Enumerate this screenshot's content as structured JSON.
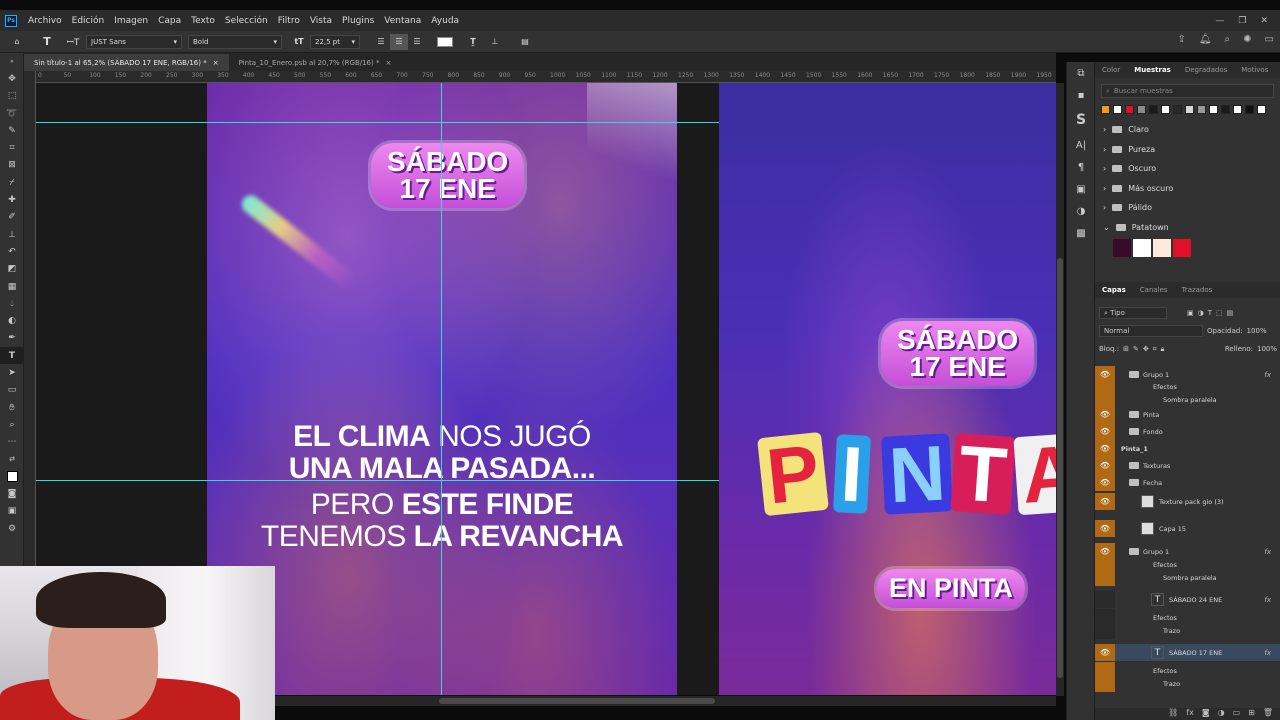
{
  "menubar": {
    "logo": "Ps",
    "items": [
      "Archivo",
      "Edición",
      "Imagen",
      "Capa",
      "Texto",
      "Selección",
      "Filtro",
      "Vista",
      "Plugins",
      "Ventana",
      "Ayuda"
    ],
    "window_controls": [
      "—",
      "❐",
      "✕"
    ]
  },
  "options_bar": {
    "font_family": "JUST Sans",
    "font_style": "Bold",
    "font_size": "22,5 pt",
    "text_color": "#ffffff"
  },
  "doc_tabs": [
    {
      "label": "Sin título-1 al 65,2% (SÁBADO 17 ENE, RGB/16) *",
      "active": true
    },
    {
      "label": "Pinta_10_Enero.psb al 20,7% (RGB/16) *",
      "active": false
    }
  ],
  "ruler_ticks": [
    "0",
    "50",
    "100",
    "150",
    "200",
    "250",
    "300",
    "350",
    "400",
    "450",
    "500",
    "550",
    "600",
    "650",
    "700",
    "750",
    "800",
    "850",
    "900",
    "950",
    "1000",
    "1050",
    "1100",
    "1150",
    "1200",
    "1250",
    "1300",
    "1350",
    "1400",
    "1450",
    "1500",
    "1550",
    "1600",
    "1650",
    "1700",
    "1750",
    "1800",
    "1850",
    "1900",
    "1950"
  ],
  "artboard1": {
    "date_line1": "SÁBADO",
    "date_line2": "17 ENE",
    "line1_bold": "EL CLIMA",
    "line1_light": "NOS JUGÓ",
    "line2_bold": "UNA MALA PASADA...",
    "line3_light": "PERO",
    "line3_bold": "ESTE FINDE",
    "line4_light": "TENEMOS",
    "line4_bold": "LA REVANCHA"
  },
  "artboard2": {
    "date_line1": "SÁBADO",
    "date_line2": "17 ENE",
    "logo_letters": [
      "P",
      "I",
      "N",
      "T",
      "A"
    ],
    "badge": "EN PINTA"
  },
  "swatches_panel": {
    "tabs": [
      "Color",
      "Muestras",
      "Degradados",
      "Motivos"
    ],
    "active_tab": "Muestras",
    "search_placeholder": "Buscar muestras",
    "recent_colors": [
      "#f39a1c",
      "#ffffff",
      "#e0102a",
      "#8a8a8a",
      "#1a1a1a",
      "#ffffff",
      "#2a2a2a",
      "#d8d8d8",
      "#9a9a9a",
      "#ffffff",
      "#1a1a1a",
      "#ffffff",
      "#111111",
      "#ffffff"
    ],
    "folders": [
      "Claro",
      "Pureza",
      "Oscuro",
      "Más oscuro",
      "Pálido",
      "Patatown"
    ],
    "patatown_colors": [
      "#3a0a2a",
      "#ffffff",
      "#fbe9dc",
      "#e0102a"
    ]
  },
  "layers_panel": {
    "tabs": [
      "Capas",
      "Canales",
      "Trazados"
    ],
    "active_tab": "Capas",
    "filter": "Tipo",
    "blend_mode": "Normal",
    "opacity_label": "Opacidad:",
    "opacity_value": "100%",
    "lock_label": "Bloq.:",
    "fill_label": "Relleno:",
    "fill_value": "100%",
    "rows": [
      {
        "name": "Grupo 1",
        "type": "group",
        "fx": "fx"
      },
      {
        "name": "Efectos",
        "type": "effects"
      },
      {
        "name": "Sombra paralela",
        "type": "effect"
      },
      {
        "name": "Pinta",
        "type": "group"
      },
      {
        "name": "Fondo",
        "type": "group"
      },
      {
        "name": "Pinta_1",
        "type": "artboard"
      },
      {
        "name": "Texturas",
        "type": "group"
      },
      {
        "name": "Fecha",
        "type": "group"
      },
      {
        "name": "Texture pack gio (3)",
        "type": "layer"
      },
      {
        "name": "Capa 15",
        "type": "layer"
      },
      {
        "name": "Grupo 1",
        "type": "group",
        "fx": "fx"
      },
      {
        "name": "Efectos",
        "type": "effects"
      },
      {
        "name": "Sombra paralela",
        "type": "effect"
      },
      {
        "name": "SÁBADO 24 ENE",
        "type": "text",
        "fx": "fx"
      },
      {
        "name": "Efectos",
        "type": "effects"
      },
      {
        "name": "Trazo",
        "type": "effect"
      },
      {
        "name": "SÁBADO 17 ENE",
        "type": "text",
        "fx": "fx",
        "selected": true
      },
      {
        "name": "Efectos",
        "type": "effects"
      },
      {
        "name": "Trazo",
        "type": "effect"
      }
    ]
  },
  "colors": {
    "accent": "#b06a16",
    "selection": "#3a4a5e",
    "guide": "#38d8e0"
  }
}
